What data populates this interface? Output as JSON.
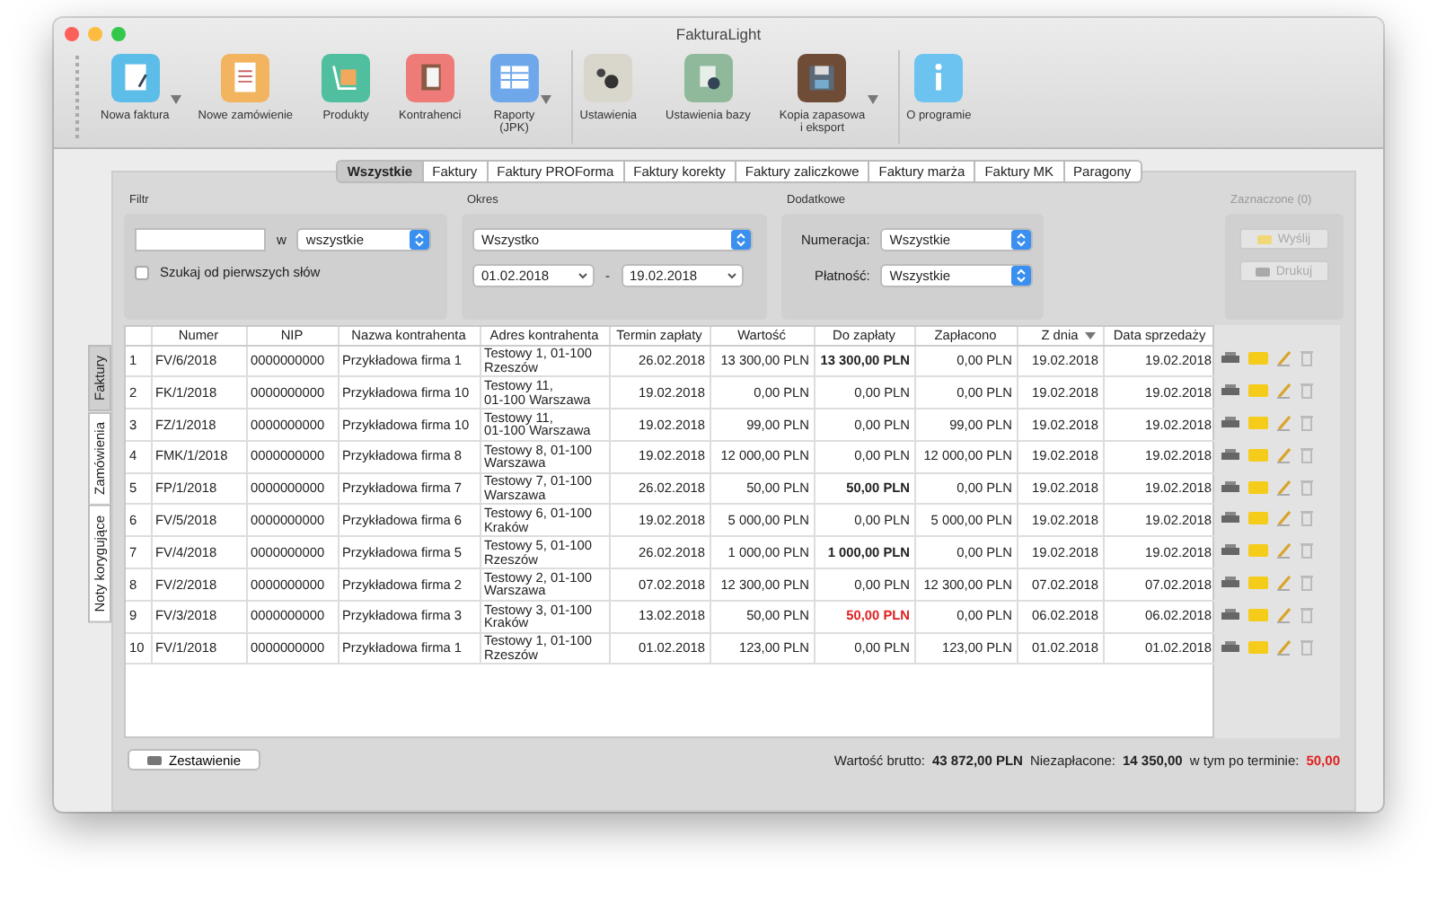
{
  "window": {
    "title": "FakturaLight"
  },
  "toolbar": {
    "groups": [
      {
        "items": [
          {
            "kind": "invoice",
            "label": "Nowa faktura",
            "color": "#5cbde9",
            "menu": true
          },
          {
            "kind": "order",
            "label": "Nowe zamówienie",
            "color": "#f2b45e",
            "menu": false
          },
          {
            "kind": "products",
            "label": "Produkty",
            "color": "#4fbf9f",
            "menu": false
          },
          {
            "kind": "contacts",
            "label": "Kontrahenci",
            "color": "#ef7b78",
            "menu": false
          },
          {
            "kind": "reports",
            "label": "Raporty\n(JPK)",
            "color": "#6fa8ea",
            "menu": true
          }
        ]
      },
      {
        "items": [
          {
            "kind": "settings",
            "label": "Ustawienia",
            "color": "#d9d6cc",
            "menu": false
          },
          {
            "kind": "database",
            "label": "Ustawienia bazy",
            "color": "#8fb99a",
            "menu": false
          },
          {
            "kind": "backup",
            "label": "Kopia zapasowa\ni eksport",
            "color": "#6e4c36",
            "menu": true
          }
        ]
      },
      {
        "items": [
          {
            "kind": "about",
            "label": "O programie",
            "color": "#6cc3f0",
            "menu": false
          }
        ]
      }
    ]
  },
  "tabs": [
    {
      "label": "Wszystkie",
      "selected": true
    },
    {
      "label": "Faktury",
      "selected": false
    },
    {
      "label": "Faktury PROForma",
      "selected": false
    },
    {
      "label": "Faktury korekty",
      "selected": false
    },
    {
      "label": "Faktury zaliczkowe",
      "selected": false
    },
    {
      "label": "Faktury marża",
      "selected": false
    },
    {
      "label": "Faktury MK",
      "selected": false
    },
    {
      "label": "Paragony",
      "selected": false
    }
  ],
  "side_tabs": [
    {
      "label": "Faktury",
      "selected": true
    },
    {
      "label": "Zamówienia",
      "selected": false
    },
    {
      "label": "Noty korygujące",
      "selected": false
    }
  ],
  "filter": {
    "title": "Filtr",
    "in_label": "w",
    "scope": "wszystkie",
    "prefix_search": {
      "label": "Szukaj od pierwszych słów",
      "checked": false
    }
  },
  "period": {
    "title": "Okres",
    "range": "Wszystko",
    "from": "01.02.2018",
    "separator": "-",
    "to": "19.02.2018"
  },
  "extra": {
    "title": "Dodatkowe",
    "numbering_label": "Numeracja:",
    "numbering": "Wszystkie",
    "payment_label": "Płatność:",
    "payment": "Wszystkie"
  },
  "selected": {
    "title": "Zaznaczone (0)",
    "buttons": [
      {
        "kind": "send",
        "label": "Wyślij",
        "disabled": true
      },
      {
        "kind": "print",
        "label": "Drukuj",
        "disabled": true
      }
    ]
  },
  "table": {
    "columns": [
      {
        "sorted": false
      },
      {
        "label": "Numer",
        "sorted": false
      },
      {
        "label": "NIP",
        "sorted": false
      },
      {
        "label": "Nazwa kontrahenta",
        "sorted": false
      },
      {
        "label": "Adres kontrahenta",
        "sorted": false
      },
      {
        "label": "Termin zapłaty",
        "sorted": false
      },
      {
        "label": "Wartość",
        "sorted": false
      },
      {
        "label": "Do zapłaty",
        "sorted": false
      },
      {
        "label": "Zapłacono",
        "sorted": false
      },
      {
        "label": "Z dnia",
        "sorted": true
      },
      {
        "label": "Data sprzedaży",
        "sorted": false
      }
    ],
    "rows": [
      {
        "cells": [
          "1",
          "FV/6/2018",
          "0000000000",
          "Przykładowa firma 1",
          "Testowy 1, 01-100 Rzeszów",
          "26.02.2018",
          "13 300,00 PLN",
          "13 300,00 PLN",
          "0,00 PLN",
          "19.02.2018",
          "19.02.2018"
        ],
        "unpaid": true,
        "overdue": false
      },
      {
        "cells": [
          "2",
          "FK/1/2018",
          "0000000000",
          "Przykładowa firma 10",
          "Testowy 11,\n01-100 Warszawa",
          "19.02.2018",
          "0,00 PLN",
          "0,00 PLN",
          "0,00 PLN",
          "19.02.2018",
          "19.02.2018"
        ],
        "unpaid": false,
        "overdue": false
      },
      {
        "cells": [
          "3",
          "FZ/1/2018",
          "0000000000",
          "Przykładowa firma 10",
          "Testowy 11,\n01-100 Warszawa",
          "19.02.2018",
          "99,00 PLN",
          "0,00 PLN",
          "99,00 PLN",
          "19.02.2018",
          "19.02.2018"
        ],
        "unpaid": false,
        "overdue": false
      },
      {
        "cells": [
          "4",
          "FMK/1/2018",
          "0000000000",
          "Przykładowa firma 8",
          "Testowy 8, 01-100 Warszawa",
          "19.02.2018",
          "12 000,00 PLN",
          "0,00 PLN",
          "12 000,00 PLN",
          "19.02.2018",
          "19.02.2018"
        ],
        "unpaid": false,
        "overdue": false
      },
      {
        "cells": [
          "5",
          "FP/1/2018",
          "0000000000",
          "Przykładowa firma 7",
          "Testowy 7, 01-100 Warszawa",
          "26.02.2018",
          "50,00 PLN",
          "50,00 PLN",
          "0,00 PLN",
          "19.02.2018",
          "19.02.2018"
        ],
        "unpaid": true,
        "overdue": false
      },
      {
        "cells": [
          "6",
          "FV/5/2018",
          "0000000000",
          "Przykładowa firma 6",
          "Testowy 6, 01-100 Kraków",
          "19.02.2018",
          "5 000,00 PLN",
          "0,00 PLN",
          "5 000,00 PLN",
          "19.02.2018",
          "19.02.2018"
        ],
        "unpaid": false,
        "overdue": false
      },
      {
        "cells": [
          "7",
          "FV/4/2018",
          "0000000000",
          "Przykładowa firma 5",
          "Testowy 5, 01-100 Rzeszów",
          "26.02.2018",
          "1 000,00 PLN",
          "1 000,00 PLN",
          "0,00 PLN",
          "19.02.2018",
          "19.02.2018"
        ],
        "unpaid": true,
        "overdue": false
      },
      {
        "cells": [
          "8",
          "FV/2/2018",
          "0000000000",
          "Przykładowa firma 2",
          "Testowy 2, 01-100 Warszawa",
          "07.02.2018",
          "12 300,00 PLN",
          "0,00 PLN",
          "12 300,00 PLN",
          "07.02.2018",
          "07.02.2018"
        ],
        "unpaid": false,
        "overdue": false
      },
      {
        "cells": [
          "9",
          "FV/3/2018",
          "0000000000",
          "Przykładowa firma 3",
          "Testowy 3, 01-100 Kraków",
          "13.02.2018",
          "50,00 PLN",
          "50,00 PLN",
          "0,00 PLN",
          "06.02.2018",
          "06.02.2018"
        ],
        "unpaid": true,
        "overdue": true
      },
      {
        "cells": [
          "10",
          "FV/1/2018",
          "0000000000",
          "Przykładowa firma 1",
          "Testowy 1, 01-100 Rzeszów",
          "01.02.2018",
          "123,00 PLN",
          "0,00 PLN",
          "123,00 PLN",
          "01.02.2018",
          "01.02.2018"
        ],
        "unpaid": false,
        "overdue": false
      }
    ]
  },
  "footer": {
    "report_button": "Zestawienie",
    "gross_label": "Wartość brutto:",
    "gross": "43 872,00 PLN",
    "unpaid_label": "Niezapłacone:",
    "unpaid": "14 350,00",
    "overdue_label": "w tym po terminie:",
    "overdue": "50,00"
  }
}
